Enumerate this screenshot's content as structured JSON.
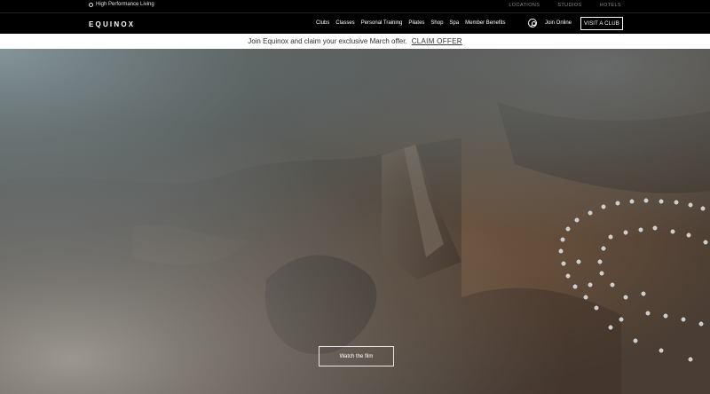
{
  "utility": {
    "tagline": "High Performance Living",
    "links": [
      "LOCATIONS",
      "STUDIOS",
      "HOTELS"
    ]
  },
  "nav": {
    "logo": "EQUINOX",
    "items": [
      "Clubs",
      "Classes",
      "Personal Training",
      "Pilates",
      "Shop",
      "Spa",
      "Member Benefits"
    ],
    "join": "Join Online",
    "visit": "VISIT A CLUB"
  },
  "promo": {
    "text": "Join Equinox and claim your exclusive March offer.",
    "cta": "CLAIM OFFER"
  },
  "hero": {
    "button": "Watch the film"
  },
  "colors": {
    "nav_bg": "#000000",
    "promo_bg": "#ffffff",
    "terrain": "#4a3d33"
  }
}
